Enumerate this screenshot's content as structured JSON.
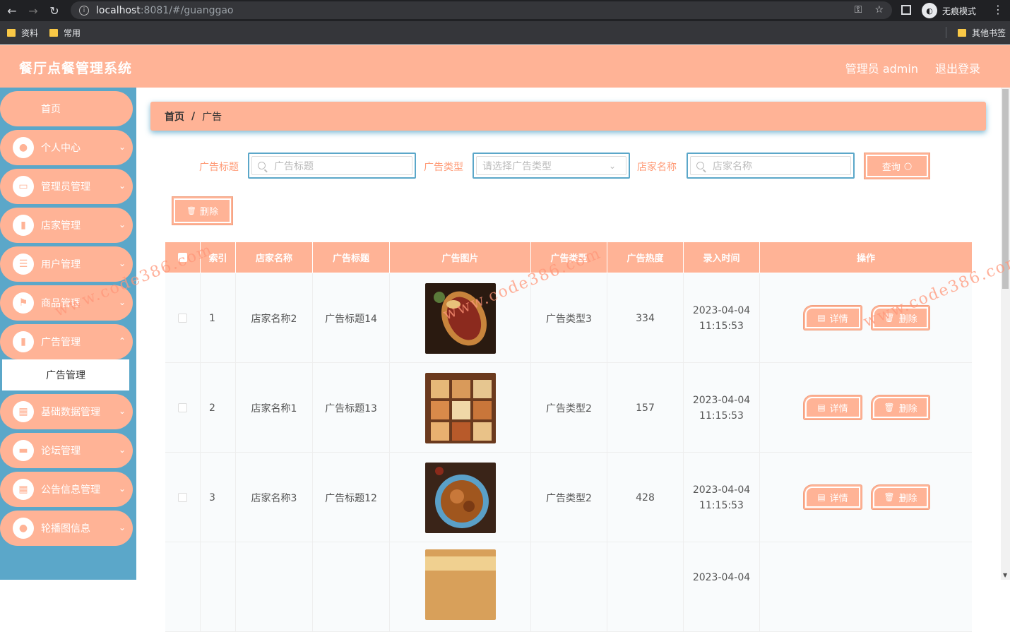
{
  "browser": {
    "url_host": "localhost",
    "url_path": ":8081/#/guanggao",
    "incognito_label": "无痕模式",
    "bookmarks": [
      "资料",
      "常用"
    ],
    "other_bookmarks": "其他书签"
  },
  "header": {
    "title": "餐厅点餐管理系统",
    "user": "管理员 admin",
    "logout": "退出登录"
  },
  "sidebar": {
    "items": [
      {
        "label": "首页",
        "icon": "home"
      },
      {
        "label": "个人中心",
        "icon": "user-icon"
      },
      {
        "label": "管理员管理",
        "icon": "monitor-icon"
      },
      {
        "label": "店家管理",
        "icon": "clipboard-icon"
      },
      {
        "label": "用户管理",
        "icon": "sliders-icon"
      },
      {
        "label": "商品管理",
        "icon": "flag-icon"
      },
      {
        "label": "广告管理",
        "icon": "clipboard-icon"
      },
      {
        "label": "基础数据管理",
        "icon": "grid-icon"
      },
      {
        "label": "论坛管理",
        "icon": "briefcase-icon"
      },
      {
        "label": "公告信息管理",
        "icon": "grid-icon"
      },
      {
        "label": "轮播图信息",
        "icon": "user-icon"
      }
    ],
    "active_sub": "广告管理"
  },
  "breadcrumb": {
    "home": "首页",
    "sep": "/",
    "current": "广告"
  },
  "search": {
    "title_label": "广告标题",
    "title_placeholder": "广告标题",
    "type_label": "广告类型",
    "type_placeholder": "请选择广告类型",
    "shop_label": "店家名称",
    "shop_placeholder": "店家名称",
    "query_button": "查询",
    "delete_button": "删除"
  },
  "table": {
    "headers": [
      "索引",
      "店家名称",
      "广告标题",
      "广告图片",
      "广告类型",
      "广告热度",
      "录入时间",
      "操作"
    ],
    "rows": [
      {
        "index": "1",
        "shop": "店家名称2",
        "title": "广告标题14",
        "type": "广告类型3",
        "heat": "334",
        "date": "2023-04-04",
        "time": "11:15:53"
      },
      {
        "index": "2",
        "shop": "店家名称1",
        "title": "广告标题13",
        "type": "广告类型2",
        "heat": "157",
        "date": "2023-04-04",
        "time": "11:15:53"
      },
      {
        "index": "3",
        "shop": "店家名称3",
        "title": "广告标题12",
        "type": "广告类型2",
        "heat": "428",
        "date": "2023-04-04",
        "time": "11:15:53"
      },
      {
        "index": "",
        "shop": "",
        "title": "",
        "type": "",
        "heat": "",
        "date": "2023-04-04",
        "time": ""
      }
    ],
    "detail_button": "详情",
    "delete_button": "删除"
  },
  "watermark": "www.code386.com",
  "colors": {
    "accent": "#ffb396",
    "sidebar": "#5ba7c9",
    "label": "#ff9b77"
  }
}
